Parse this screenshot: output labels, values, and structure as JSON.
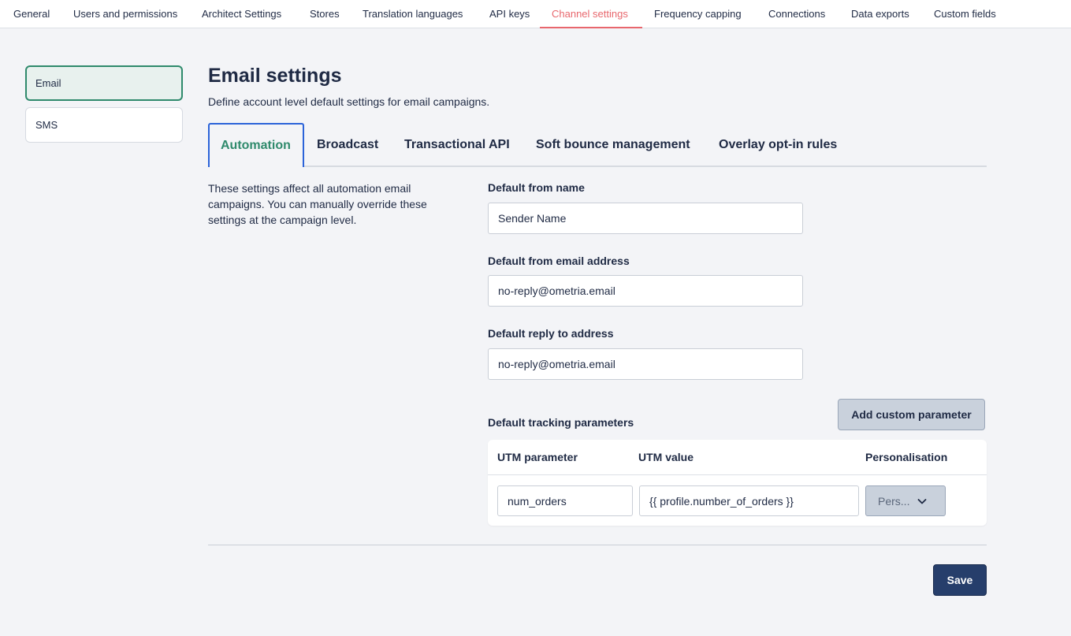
{
  "topnav": {
    "items": [
      {
        "label": "General"
      },
      {
        "label": "Users and permissions"
      },
      {
        "label": "Architect Settings"
      },
      {
        "label": "Stores"
      },
      {
        "label": "Translation languages"
      },
      {
        "label": "API keys"
      },
      {
        "label": "Channel settings",
        "active": true
      },
      {
        "label": "Frequency capping"
      },
      {
        "label": "Connections"
      },
      {
        "label": "Data exports"
      },
      {
        "label": "Custom fields"
      }
    ]
  },
  "sidebar": {
    "items": [
      {
        "label": "Email",
        "active": true
      },
      {
        "label": "SMS"
      }
    ]
  },
  "page": {
    "title": "Email settings",
    "subtitle": "Define account level default settings for email campaigns."
  },
  "tabs": [
    {
      "label": "Automation",
      "active": true
    },
    {
      "label": "Broadcast"
    },
    {
      "label": "Transactional API"
    },
    {
      "label": "Soft bounce management"
    },
    {
      "label": "Overlay opt-in rules"
    }
  ],
  "description": "These settings affect all automation email campaigns. You can manually override these settings at the campaign level.",
  "form": {
    "from_name": {
      "label": "Default from name",
      "value": "Sender Name"
    },
    "from_email": {
      "label": "Default from email address",
      "value": "no-reply@ometria.email"
    },
    "reply_to": {
      "label": "Default reply to address",
      "value": "no-reply@ometria.email"
    },
    "tracking": {
      "label": "Default tracking parameters",
      "add_button": "Add custom parameter",
      "columns": [
        "UTM parameter",
        "UTM value",
        "Personalisation"
      ],
      "rows": [
        {
          "parameter": "num_orders",
          "value": "{{ profile.number_of_orders }}",
          "personalisation": "Pers..."
        }
      ]
    }
  },
  "footer": {
    "save_label": "Save"
  },
  "colors": {
    "accent_active_nav": "#e8676d",
    "accent_green": "#2f8a6c",
    "tab_border": "#2b63d9",
    "primary_button": "#263e6b",
    "background": "#f3f4f7"
  },
  "icons": {
    "personalisation_dropdown": "chevron-down-icon"
  }
}
